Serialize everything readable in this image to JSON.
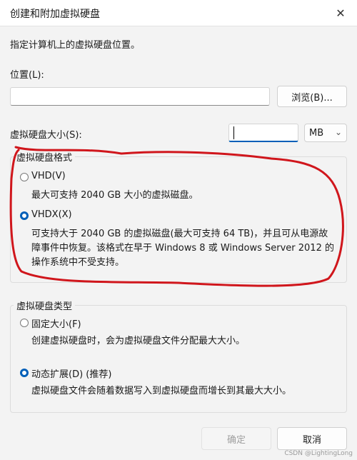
{
  "window": {
    "title": "创建和附加虚拟硬盘",
    "close_glyph": "✕"
  },
  "instruction": "指定计算机上的虚拟硬盘位置。",
  "location": {
    "label": "位置(L):",
    "value": "",
    "browse_label": "浏览(B)..."
  },
  "size": {
    "label": "虚拟硬盘大小(S):",
    "value": "",
    "unit": "MB",
    "unit_chevron": "⌄"
  },
  "format_group": {
    "legend": "虚拟硬盘格式",
    "vhd": {
      "label": "VHD(V)",
      "description": "最大可支持 2040 GB 大小的虚拟磁盘。",
      "selected": false
    },
    "vhdx": {
      "label": "VHDX(X)",
      "description_line1": "可支持大于 2040 GB 的虚拟磁盘(最大可支持 64 TB)，并且可从电源故",
      "description_line2": "障事件中恢复。该格式在早于 Windows 8 或 Windows Server 2012 的",
      "description_line3": "操作系统中不受支持。",
      "selected": true
    }
  },
  "type_group": {
    "legend": "虚拟硬盘类型",
    "fixed": {
      "label": "固定大小(F)",
      "description": "创建虚拟硬盘时，会为虚拟硬盘文件分配最大大小。",
      "selected": false
    },
    "dynamic": {
      "label": "动态扩展(D) (推荐)",
      "description": "虚拟硬盘文件会随着数据写入到虚拟硬盘而增长到其最大大小。",
      "selected": true
    }
  },
  "buttons": {
    "ok_label": "确定",
    "cancel_label": "取消"
  },
  "watermark": "CSDN @LightingLong",
  "annotation": {
    "color": "#d0161c"
  },
  "colors": {
    "accent": "#005fb8"
  }
}
